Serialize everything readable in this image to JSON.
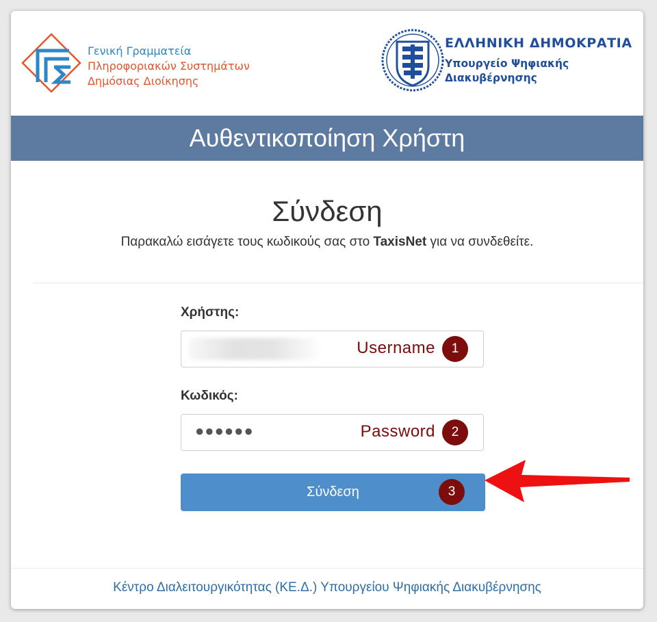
{
  "header": {
    "gsis": {
      "line1": "Γενική Γραμματεία",
      "line2": "Πληροφοριακών Συστημάτων",
      "line3": "Δημόσιας Διοίκησης",
      "logo_icon": "gsis-logo-icon"
    },
    "gov": {
      "title": "ΕΛΛΗΝΙΚΗ ΔΗΜΟΚΡΑΤΙΑ",
      "sub1": "Υπουργείο Ψηφιακής",
      "sub2": "Διακυβέρνησης",
      "seal_icon": "greek-coat-of-arms-icon"
    }
  },
  "banner": {
    "title": "Αυθεντικοποίηση Χρήστη"
  },
  "login": {
    "title": "Σύνδεση",
    "subtitle_before": "Παρακαλώ εισάγετε τους κωδικούς σας στο ",
    "subtitle_bold": "TaxisNet",
    "subtitle_after": " για να συνδεθείτε.",
    "username": {
      "label": "Χρήστης:",
      "hint": "Username",
      "badge": "1"
    },
    "password": {
      "label": "Κωδικός:",
      "value": "●●●●●●",
      "hint": "Password",
      "badge": "2"
    },
    "submit": {
      "label": "Σύνδεση",
      "badge": "3"
    }
  },
  "footer": {
    "text": "Κέντρο Διαλειτουργικότητας (ΚΕ.Δ.) Υπουργείου Ψηφιακής Διακυβέρνησης"
  },
  "colors": {
    "banner": "#5d7aa0",
    "button": "#4e8ecb",
    "badge": "#7d0d0d",
    "arrow": "#ee1111",
    "link": "#2d6da8",
    "gov_blue": "#1f4e9d",
    "gsis_blue": "#2d86c6",
    "gsis_orange": "#e4552b"
  }
}
